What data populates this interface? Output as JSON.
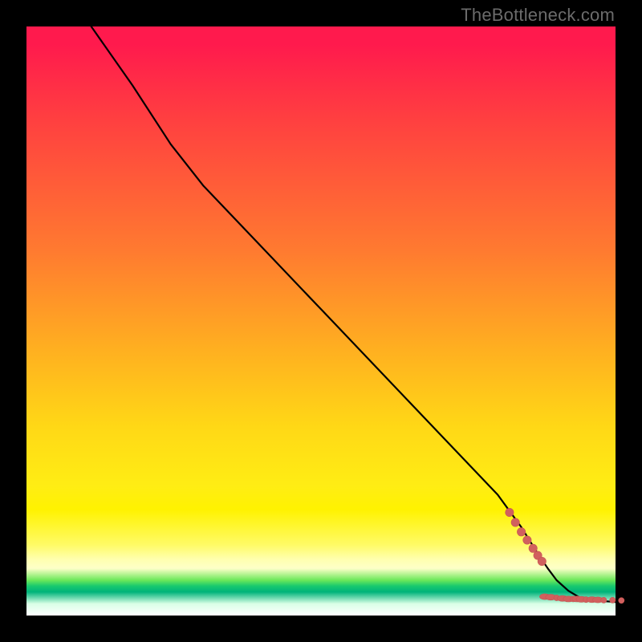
{
  "watermark": "TheBottleneck.com",
  "colors": {
    "curve": "#000000",
    "dots": "#d1605e",
    "dots_stroke": "#c75452"
  },
  "chart_data": {
    "type": "line",
    "title": "",
    "xlabel": "",
    "ylabel": "",
    "xlim": [
      0,
      100
    ],
    "ylim": [
      0,
      100
    ],
    "grid": false,
    "legend": false,
    "note": "Axes are unlabeled in the image; values are normalized 0–100 estimates read from pixel positions. The black curve is the bottleneck/fit curve; dusty-red dots & dashes are data markers clustered at the bottom-right.",
    "series": [
      {
        "name": "curve",
        "style": "line",
        "color": "#000000",
        "x": [
          11,
          18,
          24.5,
          30,
          40,
          50,
          60,
          70,
          80,
          84,
          86.5,
          88.5,
          90,
          92,
          94,
          97,
          100
        ],
        "y": [
          100,
          90,
          80,
          73,
          62.5,
          52,
          41.5,
          31,
          20.5,
          15,
          11,
          8,
          6,
          4.2,
          3,
          2.5,
          2.3
        ]
      },
      {
        "name": "dot-cluster-on-curve",
        "style": "scatter",
        "color": "#d1605e",
        "x": [
          82,
          83,
          84,
          85,
          86,
          86.8,
          87.5
        ],
        "y": [
          17.5,
          15.8,
          14.2,
          12.8,
          11.4,
          10.2,
          9.2
        ]
      },
      {
        "name": "dot-trail-bottom",
        "style": "scatter",
        "color": "#d1605e",
        "x": [
          88,
          89,
          90,
          91,
          92,
          92.8,
          93.5,
          94.2,
          95,
          96,
          97,
          98,
          99.5,
          101
        ],
        "y": [
          3.2,
          3.1,
          3.0,
          2.9,
          2.8,
          2.8,
          2.8,
          2.75,
          2.7,
          2.7,
          2.65,
          2.6,
          2.6,
          2.55
        ]
      }
    ]
  }
}
